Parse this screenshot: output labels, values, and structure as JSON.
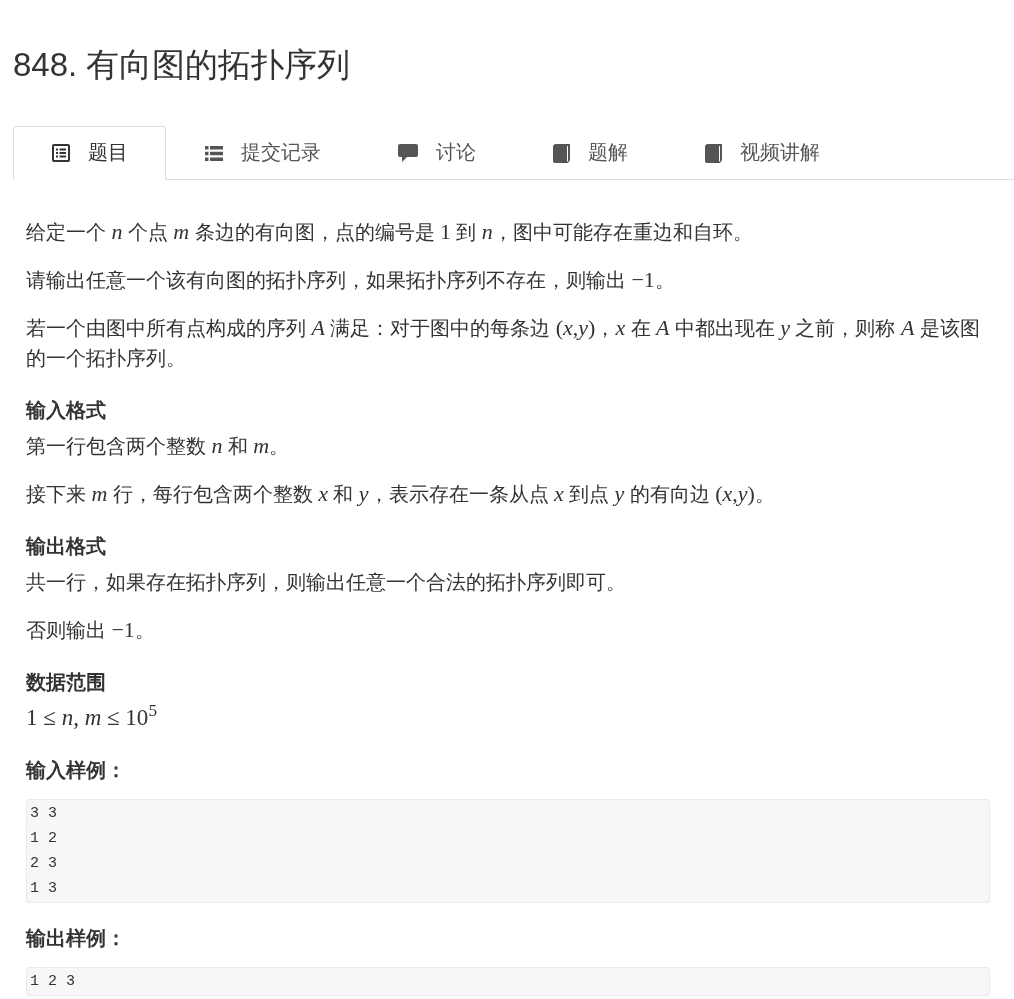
{
  "title": "848. 有向图的拓扑序列",
  "tabs": [
    {
      "label": "题目",
      "selected": true
    },
    {
      "label": "提交记录",
      "selected": false
    },
    {
      "label": "讨论",
      "selected": false
    },
    {
      "label": "题解",
      "selected": false
    },
    {
      "label": "视频讲解",
      "selected": false
    }
  ],
  "content": [
    {
      "kind": "paragraph",
      "parts": [
        {
          "kind": "text",
          "text": "给定一个 "
        },
        {
          "kind": "math",
          "text": "*n*"
        },
        {
          "kind": "text",
          "text": " 个点 "
        },
        {
          "kind": "math",
          "text": "*m*"
        },
        {
          "kind": "text",
          "text": " 条边的有向图，点的编号是 "
        },
        {
          "kind": "math",
          "text": "1"
        },
        {
          "kind": "text",
          "text": " 到 "
        },
        {
          "kind": "math",
          "text": "*n*"
        },
        {
          "kind": "text",
          "text": "，图中可能存在重边和自环。"
        }
      ]
    },
    {
      "kind": "paragraph",
      "parts": [
        {
          "kind": "text",
          "text": "请输出任意一个该有向图的拓扑序列，如果拓扑序列不存在，则输出 "
        },
        {
          "kind": "math",
          "text": "−1"
        },
        {
          "kind": "text",
          "text": "。"
        }
      ]
    },
    {
      "kind": "paragraph",
      "parts": [
        {
          "kind": "text",
          "text": "若一个由图中所有点构成的序列 "
        },
        {
          "kind": "math",
          "text": "*A*"
        },
        {
          "kind": "text",
          "text": " 满足：对于图中的每条边 "
        },
        {
          "kind": "math",
          "text": "(*x*,*y*)"
        },
        {
          "kind": "text",
          "text": "，"
        },
        {
          "kind": "math",
          "text": "*x*"
        },
        {
          "kind": "text",
          "text": " 在 "
        },
        {
          "kind": "math",
          "text": "*A*"
        },
        {
          "kind": "text",
          "text": " 中都出现在 "
        },
        {
          "kind": "math",
          "text": "*y*"
        },
        {
          "kind": "text",
          "text": " 之前，则称 "
        },
        {
          "kind": "math",
          "text": "*A*"
        },
        {
          "kind": "text",
          "text": " 是该图的一个拓扑序列。"
        }
      ]
    },
    {
      "kind": "heading",
      "text": "输入格式"
    },
    {
      "kind": "paragraph",
      "parts": [
        {
          "kind": "text",
          "text": "第一行包含两个整数 "
        },
        {
          "kind": "math",
          "text": "*n*"
        },
        {
          "kind": "text",
          "text": " 和 "
        },
        {
          "kind": "math",
          "text": "*m*"
        },
        {
          "kind": "text",
          "text": "。"
        }
      ]
    },
    {
      "kind": "paragraph",
      "parts": [
        {
          "kind": "text",
          "text": "接下来 "
        },
        {
          "kind": "math",
          "text": "*m*"
        },
        {
          "kind": "text",
          "text": " 行，每行包含两个整数 "
        },
        {
          "kind": "math",
          "text": "*x*"
        },
        {
          "kind": "text",
          "text": " 和 "
        },
        {
          "kind": "math",
          "text": "*y*"
        },
        {
          "kind": "text",
          "text": "，表示存在一条从点 "
        },
        {
          "kind": "math",
          "text": "*x*"
        },
        {
          "kind": "text",
          "text": " 到点 "
        },
        {
          "kind": "math",
          "text": "*y*"
        },
        {
          "kind": "text",
          "text": " 的有向边 "
        },
        {
          "kind": "math",
          "text": "(*x*,*y*)"
        },
        {
          "kind": "text",
          "text": "。"
        }
      ]
    },
    {
      "kind": "heading",
      "text": "输出格式"
    },
    {
      "kind": "paragraph",
      "parts": [
        {
          "kind": "text",
          "text": "共一行，如果存在拓扑序列，则输出任意一个合法的拓扑序列即可。"
        }
      ]
    },
    {
      "kind": "paragraph",
      "parts": [
        {
          "kind": "text",
          "text": "否则输出 "
        },
        {
          "kind": "math",
          "text": "−1"
        },
        {
          "kind": "text",
          "text": "。"
        }
      ]
    },
    {
      "kind": "heading",
      "text": "数据范围"
    },
    {
      "kind": "formula",
      "text": "1 ≤ *n*, *m* ≤ 10$^{5}$"
    },
    {
      "kind": "heading",
      "text": "输入样例："
    },
    {
      "kind": "code",
      "lines": [
        "3 3",
        "1 2",
        "2 3",
        "1 3"
      ]
    },
    {
      "kind": "heading",
      "text": "输出样例："
    },
    {
      "kind": "code",
      "lines": [
        "1 2 3"
      ]
    }
  ]
}
